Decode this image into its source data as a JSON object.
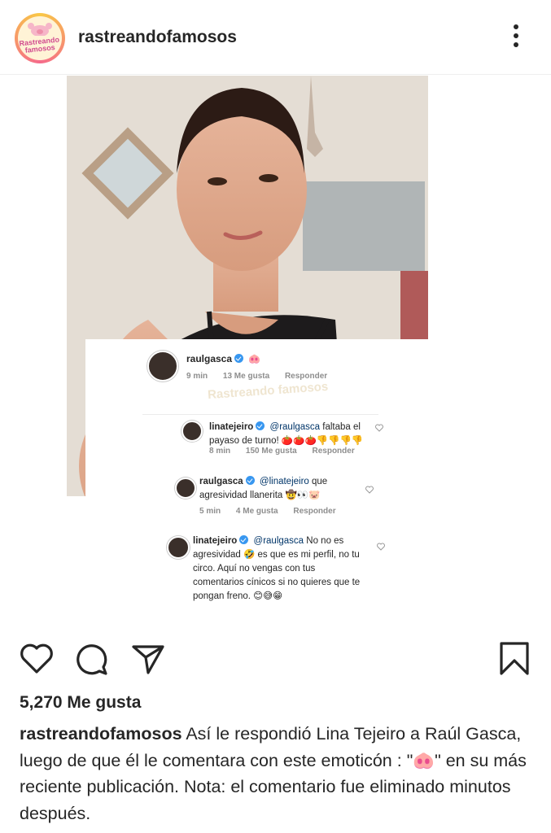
{
  "header": {
    "username": "rastreandofamosos",
    "avatar_text_line1": "Rastreando",
    "avatar_text_line2": "famosos"
  },
  "post": {
    "comments": [
      {
        "user": "raulgasca",
        "text": "🐽",
        "time": "9 min",
        "likes": "13 Me gusta",
        "reply": "Responder"
      },
      {
        "user": "linatejeiro",
        "mention": "@raulgasca",
        "text": "faltaba el payaso de turno! 🍅🍅🍅👎👎👎👎",
        "time": "8 min",
        "likes": "150 Me gusta",
        "reply": "Responder"
      },
      {
        "user": "raulgasca",
        "mention": "@linatejeiro",
        "text": "que agresividad llanerita 🤠👀🐷",
        "time": "5 min",
        "likes": "4 Me gusta",
        "reply": "Responder"
      },
      {
        "user": "linatejeiro",
        "mention": "@raulgasca",
        "text": "No no es agresividad 🤣 es que es mi perfil, no tu circo. Aquí no vengas con tus comentarios cínicos si no quieres que te pongan freno. 😊😅😁"
      }
    ],
    "watermark": "Rastreando famosos"
  },
  "actions": {
    "icons": [
      "heart-icon",
      "comment-icon",
      "share-icon",
      "bookmark-icon"
    ]
  },
  "likes_count": "5,270 Me gusta",
  "caption": {
    "user": "rastreandofamosos",
    "text": "Así le respondió Lina Tejeiro a Raúl Gasca, luego de que él le comentara con este emoticón : \"🐽\" en su más reciente publicación. Nota: el comentario fue eliminado minutos después."
  },
  "colors": {
    "text": "#262626",
    "meta": "#8e8e8e",
    "verified": "#3897f0",
    "mention": "#003569"
  }
}
